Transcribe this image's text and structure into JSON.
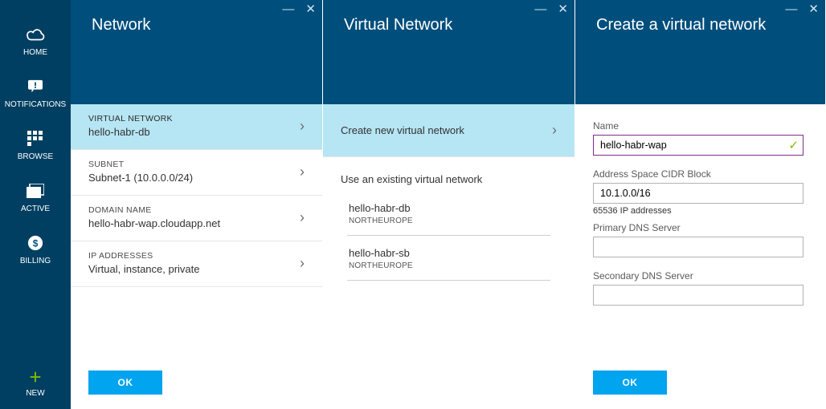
{
  "sidebar": {
    "items": [
      {
        "label": "HOME"
      },
      {
        "label": "NOTIFICATIONS"
      },
      {
        "label": "BROWSE"
      },
      {
        "label": "ACTIVE"
      },
      {
        "label": "BILLING"
      }
    ],
    "new_label": "NEW"
  },
  "blade1": {
    "title": "Network",
    "rows": [
      {
        "label": "VIRTUAL NETWORK",
        "value": "hello-habr-db"
      },
      {
        "label": "SUBNET",
        "value": "Subnet-1 (10.0.0.0/24)"
      },
      {
        "label": "DOMAIN NAME",
        "value": "hello-habr-wap.cloudapp.net"
      },
      {
        "label": "IP ADDRESSES",
        "value": "Virtual, instance, private"
      }
    ],
    "ok": "OK"
  },
  "blade2": {
    "title": "Virtual Network",
    "create_label": "Create new virtual network",
    "existing_label": "Use an existing virtual network",
    "vnets": [
      {
        "name": "hello-habr-db",
        "location": "NORTHEUROPE"
      },
      {
        "name": "hello-habr-sb",
        "location": "NORTHEUROPE"
      }
    ]
  },
  "blade3": {
    "title": "Create a virtual network",
    "fields": {
      "name_label": "Name",
      "name_value": "hello-habr-wap",
      "cidr_label": "Address Space CIDR Block",
      "cidr_value": "10.1.0.0/16",
      "cidr_hint": "65536 IP addresses",
      "dns1_label": "Primary DNS Server",
      "dns1_value": "",
      "dns2_label": "Secondary DNS Server",
      "dns2_value": ""
    },
    "ok": "OK"
  }
}
